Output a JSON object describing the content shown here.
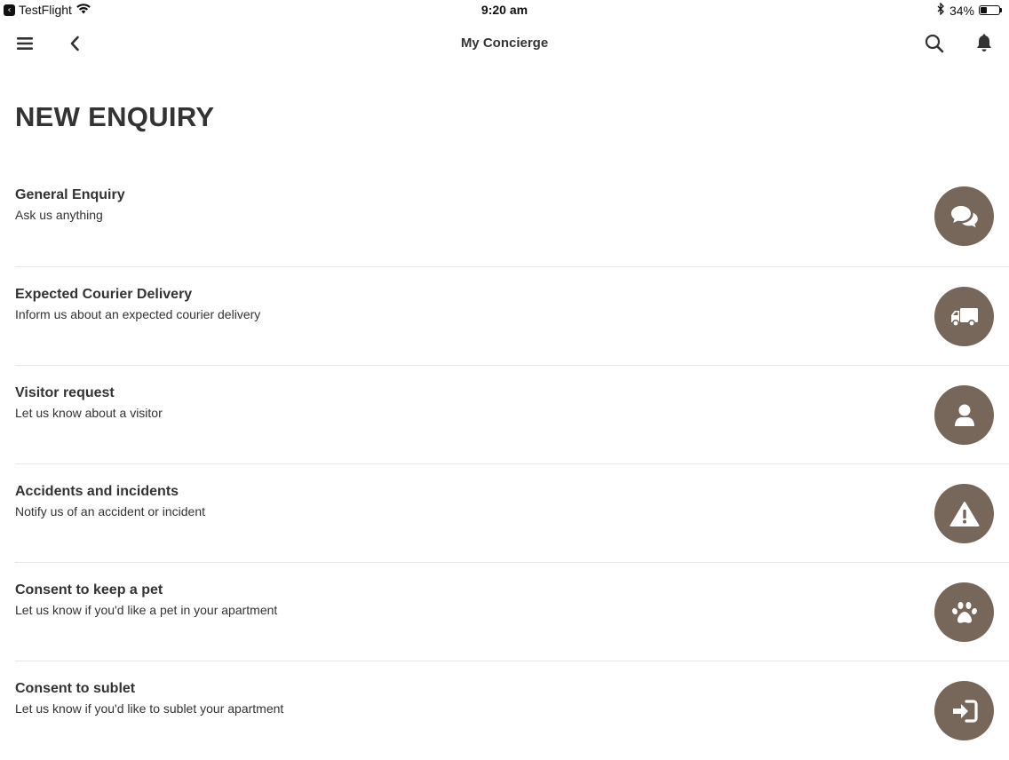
{
  "status_bar": {
    "app_name": "TestFlight",
    "time": "9:20 am",
    "battery": "34%",
    "battery_level": 0.34
  },
  "nav": {
    "title": "My Concierge",
    "menu_icon": "hamburger-menu-icon",
    "back_icon": "chevron-left-icon",
    "search_icon": "search-icon",
    "bell_icon": "bell-icon"
  },
  "page": {
    "title": "NEW ENQUIRY"
  },
  "colors": {
    "icon_circle": "#76675a",
    "text": "#333333",
    "divider": "#e6e6e6"
  },
  "items": [
    {
      "title": "General Enquiry",
      "subtitle": "Ask us anything",
      "icon": "chat-bubbles-icon"
    },
    {
      "title": "Expected Courier Delivery",
      "subtitle": "Inform us about an expected courier delivery",
      "icon": "delivery-truck-icon"
    },
    {
      "title": "Visitor request",
      "subtitle": "Let us know about a visitor",
      "icon": "person-icon"
    },
    {
      "title": "Accidents and incidents",
      "subtitle": "Notify us of an accident or incident",
      "icon": "warning-icon"
    },
    {
      "title": "Consent to keep a pet",
      "subtitle": "Let us know if you'd like a pet in your apartment",
      "icon": "paw-icon"
    },
    {
      "title": "Consent to sublet",
      "subtitle": "Let us know if you'd like to sublet your apartment",
      "icon": "sign-in-icon"
    }
  ]
}
